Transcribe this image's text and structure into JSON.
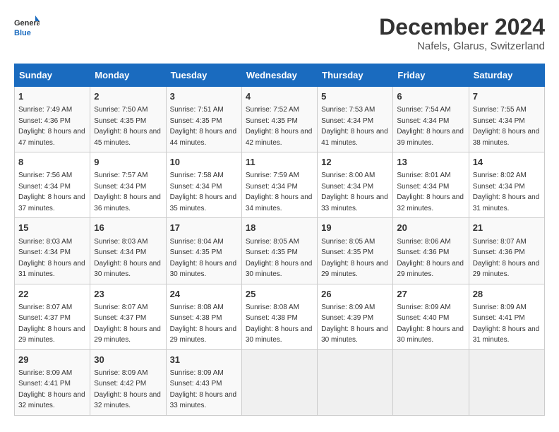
{
  "logo": {
    "line1": "General",
    "line2": "Blue"
  },
  "title": "December 2024",
  "location": "Nafels, Glarus, Switzerland",
  "headers": [
    "Sunday",
    "Monday",
    "Tuesday",
    "Wednesday",
    "Thursday",
    "Friday",
    "Saturday"
  ],
  "weeks": [
    [
      {
        "day": "1",
        "sunrise": "7:49 AM",
        "sunset": "4:36 PM",
        "daylight": "8 hours and 47 minutes."
      },
      {
        "day": "2",
        "sunrise": "7:50 AM",
        "sunset": "4:35 PM",
        "daylight": "8 hours and 45 minutes."
      },
      {
        "day": "3",
        "sunrise": "7:51 AM",
        "sunset": "4:35 PM",
        "daylight": "8 hours and 44 minutes."
      },
      {
        "day": "4",
        "sunrise": "7:52 AM",
        "sunset": "4:35 PM",
        "daylight": "8 hours and 42 minutes."
      },
      {
        "day": "5",
        "sunrise": "7:53 AM",
        "sunset": "4:34 PM",
        "daylight": "8 hours and 41 minutes."
      },
      {
        "day": "6",
        "sunrise": "7:54 AM",
        "sunset": "4:34 PM",
        "daylight": "8 hours and 39 minutes."
      },
      {
        "day": "7",
        "sunrise": "7:55 AM",
        "sunset": "4:34 PM",
        "daylight": "8 hours and 38 minutes."
      }
    ],
    [
      {
        "day": "8",
        "sunrise": "7:56 AM",
        "sunset": "4:34 PM",
        "daylight": "8 hours and 37 minutes."
      },
      {
        "day": "9",
        "sunrise": "7:57 AM",
        "sunset": "4:34 PM",
        "daylight": "8 hours and 36 minutes."
      },
      {
        "day": "10",
        "sunrise": "7:58 AM",
        "sunset": "4:34 PM",
        "daylight": "8 hours and 35 minutes."
      },
      {
        "day": "11",
        "sunrise": "7:59 AM",
        "sunset": "4:34 PM",
        "daylight": "8 hours and 34 minutes."
      },
      {
        "day": "12",
        "sunrise": "8:00 AM",
        "sunset": "4:34 PM",
        "daylight": "8 hours and 33 minutes."
      },
      {
        "day": "13",
        "sunrise": "8:01 AM",
        "sunset": "4:34 PM",
        "daylight": "8 hours and 32 minutes."
      },
      {
        "day": "14",
        "sunrise": "8:02 AM",
        "sunset": "4:34 PM",
        "daylight": "8 hours and 31 minutes."
      }
    ],
    [
      {
        "day": "15",
        "sunrise": "8:03 AM",
        "sunset": "4:34 PM",
        "daylight": "8 hours and 31 minutes."
      },
      {
        "day": "16",
        "sunrise": "8:03 AM",
        "sunset": "4:34 PM",
        "daylight": "8 hours and 30 minutes."
      },
      {
        "day": "17",
        "sunrise": "8:04 AM",
        "sunset": "4:35 PM",
        "daylight": "8 hours and 30 minutes."
      },
      {
        "day": "18",
        "sunrise": "8:05 AM",
        "sunset": "4:35 PM",
        "daylight": "8 hours and 30 minutes."
      },
      {
        "day": "19",
        "sunrise": "8:05 AM",
        "sunset": "4:35 PM",
        "daylight": "8 hours and 29 minutes."
      },
      {
        "day": "20",
        "sunrise": "8:06 AM",
        "sunset": "4:36 PM",
        "daylight": "8 hours and 29 minutes."
      },
      {
        "day": "21",
        "sunrise": "8:07 AM",
        "sunset": "4:36 PM",
        "daylight": "8 hours and 29 minutes."
      }
    ],
    [
      {
        "day": "22",
        "sunrise": "8:07 AM",
        "sunset": "4:37 PM",
        "daylight": "8 hours and 29 minutes."
      },
      {
        "day": "23",
        "sunrise": "8:07 AM",
        "sunset": "4:37 PM",
        "daylight": "8 hours and 29 minutes."
      },
      {
        "day": "24",
        "sunrise": "8:08 AM",
        "sunset": "4:38 PM",
        "daylight": "8 hours and 29 minutes."
      },
      {
        "day": "25",
        "sunrise": "8:08 AM",
        "sunset": "4:38 PM",
        "daylight": "8 hours and 30 minutes."
      },
      {
        "day": "26",
        "sunrise": "8:09 AM",
        "sunset": "4:39 PM",
        "daylight": "8 hours and 30 minutes."
      },
      {
        "day": "27",
        "sunrise": "8:09 AM",
        "sunset": "4:40 PM",
        "daylight": "8 hours and 30 minutes."
      },
      {
        "day": "28",
        "sunrise": "8:09 AM",
        "sunset": "4:41 PM",
        "daylight": "8 hours and 31 minutes."
      }
    ],
    [
      {
        "day": "29",
        "sunrise": "8:09 AM",
        "sunset": "4:41 PM",
        "daylight": "8 hours and 32 minutes."
      },
      {
        "day": "30",
        "sunrise": "8:09 AM",
        "sunset": "4:42 PM",
        "daylight": "8 hours and 32 minutes."
      },
      {
        "day": "31",
        "sunrise": "8:09 AM",
        "sunset": "4:43 PM",
        "daylight": "8 hours and 33 minutes."
      },
      null,
      null,
      null,
      null
    ]
  ],
  "labels": {
    "sunrise": "Sunrise:",
    "sunset": "Sunset:",
    "daylight": "Daylight:"
  }
}
